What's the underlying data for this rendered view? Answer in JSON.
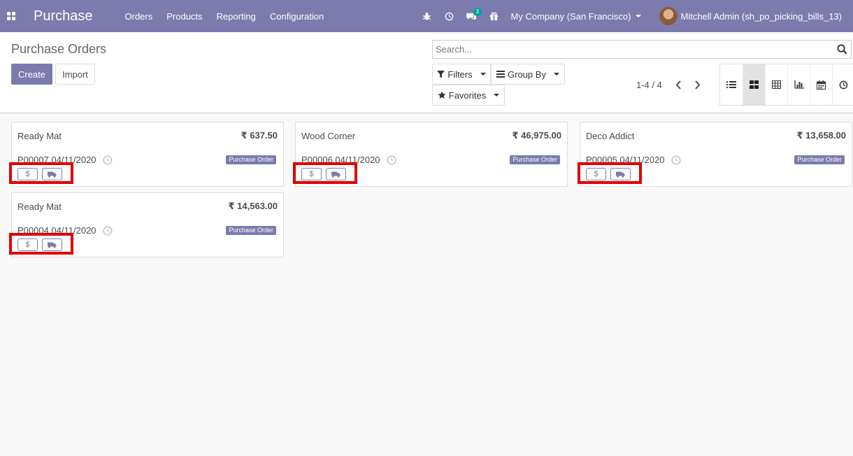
{
  "navbar": {
    "brand": "Purchase",
    "menu": [
      "Orders",
      "Products",
      "Reporting",
      "Configuration"
    ],
    "messages_count": "3",
    "company": "My Company (San Francisco)",
    "user": "Mitchell Admin (sh_po_picking_bills_13)",
    "icons": [
      "apps-icon",
      "bug-icon",
      "clock-icon",
      "chat-icon",
      "gift-icon"
    ]
  },
  "control_panel": {
    "title": "Purchase Orders",
    "create_label": "Create",
    "import_label": "Import",
    "search_placeholder": "Search...",
    "filters_label": "Filters",
    "group_by_label": "Group By",
    "favorites_label": "Favorites",
    "pager": "1-4 / 4",
    "views": [
      "list-view-icon",
      "kanban-view-icon",
      "pivot-view-icon",
      "graph-view-icon",
      "calendar-view-icon",
      "activity-view-icon"
    ],
    "active_view": "kanban-view-icon"
  },
  "cards": [
    {
      "partner": "Ready Mat",
      "amount": "₹ 637.50",
      "ref": "P00007 04/11/2020",
      "state": "Purchase Order"
    },
    {
      "partner": "Wood Corner",
      "amount": "₹ 46,975.00",
      "ref": "P00006 04/11/2020",
      "state": "Purchase Order"
    },
    {
      "partner": "Deco Addict",
      "amount": "₹ 13,658.00",
      "ref": "P00005 04/11/2020",
      "state": "Purchase Order"
    },
    {
      "partner": "Ready Mat",
      "amount": "₹ 14,563.00",
      "ref": "P00004 04/11/2020",
      "state": "Purchase Order"
    }
  ],
  "colors": {
    "brand": "#7c7bad",
    "highlight": "#e10000",
    "badge": "#00a09d"
  }
}
